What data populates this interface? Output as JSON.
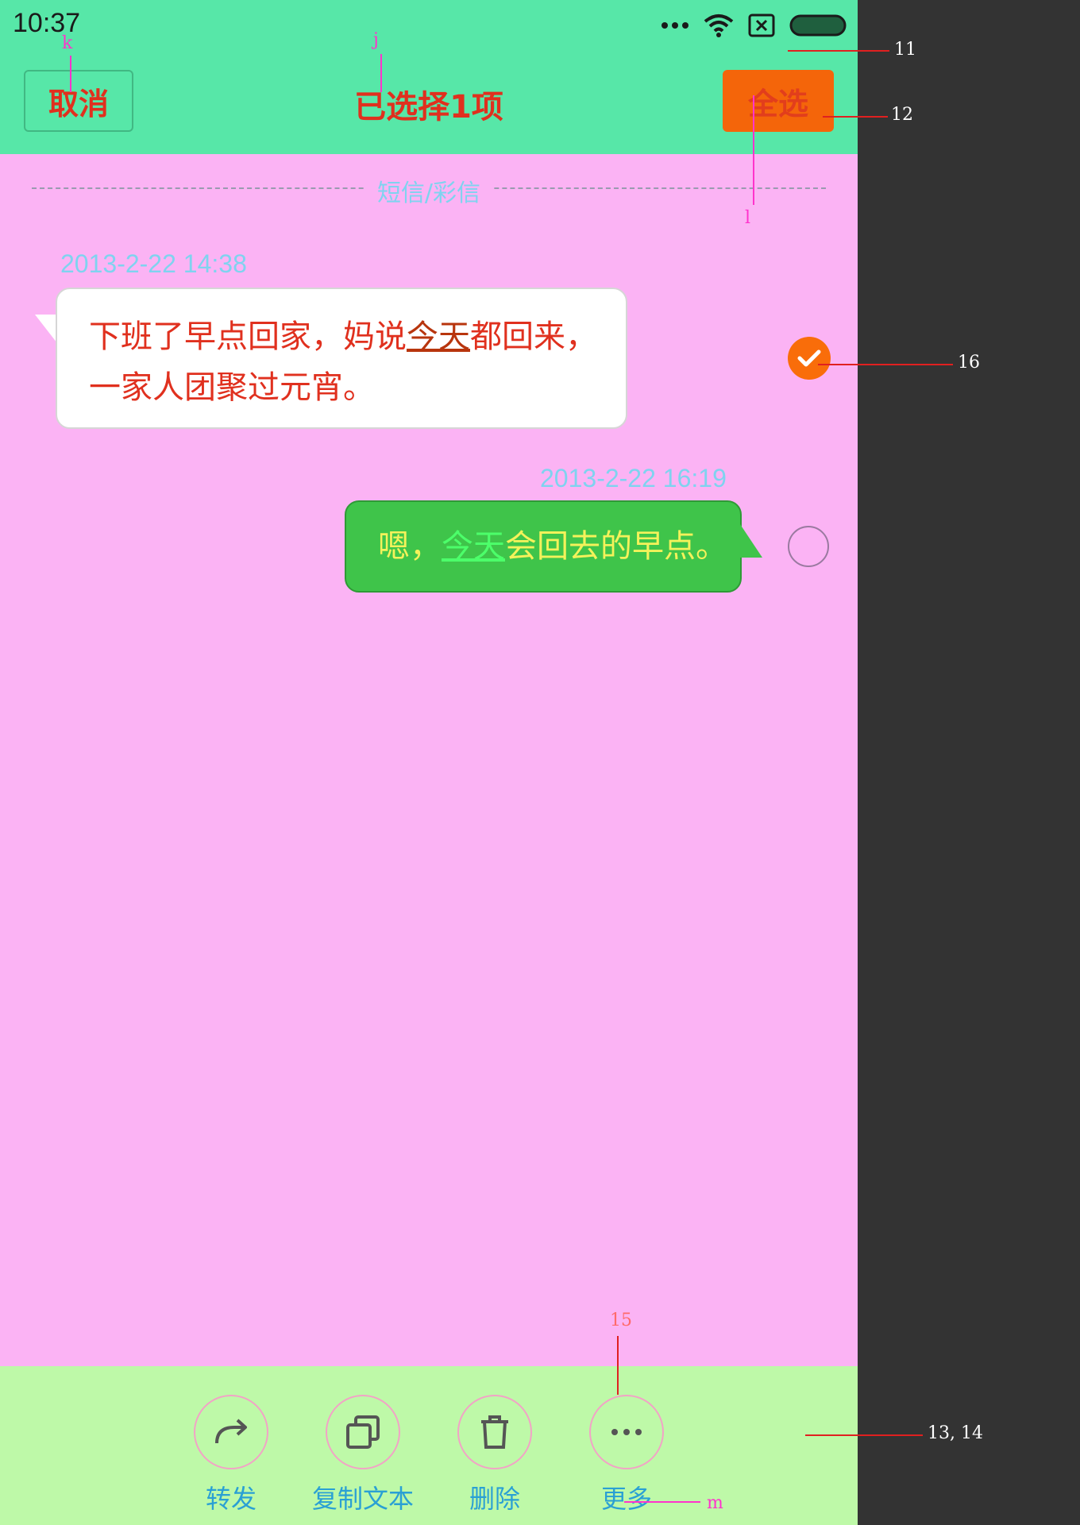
{
  "status_bar": {
    "time": "10:37"
  },
  "header": {
    "cancel_label": "取消",
    "title": "已选择1项",
    "select_all_label": "全选"
  },
  "thread": {
    "divider_label": "短信/彩信",
    "messages": [
      {
        "direction": "incoming",
        "timestamp": "2013-2-22 14:38",
        "text_before": "下班了早点回家，妈说",
        "text_link": "今天",
        "text_after": "都回来，一家人团聚过元宵。",
        "selected": true
      },
      {
        "direction": "outgoing",
        "timestamp": "2013-2-22 16:19",
        "text_before": "嗯，",
        "text_link": "今天",
        "text_after": "会回去的早点。",
        "selected": false
      }
    ]
  },
  "toolbar": {
    "actions": [
      {
        "label": "转发",
        "icon": "forward-icon"
      },
      {
        "label": "复制文本",
        "icon": "copy-icon"
      },
      {
        "label": "删除",
        "icon": "trash-icon"
      },
      {
        "label": "更多",
        "icon": "more-icon"
      }
    ]
  },
  "annotations": {
    "k": "k",
    "j": "j",
    "l": "l",
    "m": "m",
    "n11": "11",
    "n12": "12",
    "n13": "13, 14",
    "n15": "15",
    "n16": "16"
  },
  "colors": {
    "header_bg": "#57e7a8",
    "thread_bg": "#fbb3f4",
    "toolbar_bg": "#bef9a8",
    "accent_orange": "#f96d0a",
    "title_red": "#e0301e",
    "outgoing_bubble": "#3fc44a"
  }
}
